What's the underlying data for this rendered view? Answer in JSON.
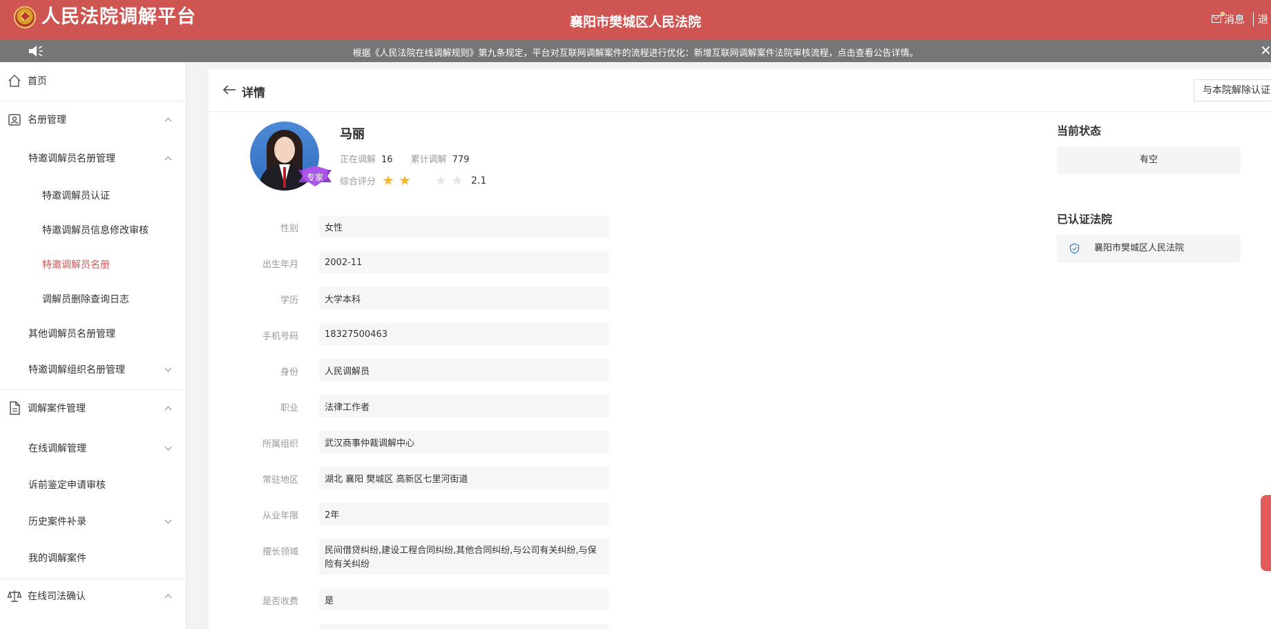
{
  "header": {
    "app_title": "人民法院调解平台",
    "court_name": "襄阳市樊城区人民法院",
    "messages_label": "消息",
    "logout_label": "退"
  },
  "notice": {
    "text": "根据《人民法院在线调解规则》第九条规定，平台对互联网调解案件的流程进行优化：新增互联网调解案件法院审核流程，点击查看公告详情。",
    "close": "✕"
  },
  "sidebar": {
    "items": [
      {
        "label": "首页"
      },
      {
        "label": "名册管理"
      },
      {
        "label": "特邀调解员名册管理"
      },
      {
        "label": "特邀调解员认证"
      },
      {
        "label": "特邀调解员信息修改审核"
      },
      {
        "label": "特邀调解员名册"
      },
      {
        "label": "调解员删除查询日志"
      },
      {
        "label": "其他调解员名册管理"
      },
      {
        "label": "特邀调解组织名册管理"
      },
      {
        "label": "调解案件管理"
      },
      {
        "label": "在线调解管理"
      },
      {
        "label": "诉前鉴定申请审核"
      },
      {
        "label": "历史案件补录"
      },
      {
        "label": "我的调解案件"
      },
      {
        "label": "在线司法确认"
      }
    ]
  },
  "detail": {
    "title": "详情",
    "revoke_button": "与本院解除认证",
    "badge": "专家",
    "name": "马丽",
    "ongoing_label": "正在调解",
    "ongoing_value": "16",
    "total_label": "累计调解",
    "total_value": "779",
    "rating_label": "综合评分",
    "rating_value": "2.1",
    "fields": [
      {
        "label": "性别",
        "value": "女性"
      },
      {
        "label": "出生年月",
        "value": "2002-11"
      },
      {
        "label": "学历",
        "value": "大学本科"
      },
      {
        "label": "手机号码",
        "value": "18327500463"
      },
      {
        "label": "身份",
        "value": "人民调解员"
      },
      {
        "label": "职业",
        "value": "法律工作者"
      },
      {
        "label": "所属组织",
        "value": "武汉商事仲裁调解中心"
      },
      {
        "label": "常驻地区",
        "value": "湖北 襄阳 樊城区 高新区七里河街道"
      },
      {
        "label": "从业年限",
        "value": "2年"
      },
      {
        "label": "擅长领域",
        "value": "民间借贷纠纷,建设工程合同纠纷,其他合同纠纷,与公司有关纠纷,与保险有关纠纷"
      },
      {
        "label": "是否收费",
        "value": "是"
      }
    ]
  },
  "status": {
    "title": "当前状态",
    "value": "有空"
  },
  "certified": {
    "title": "已认证法院",
    "court": "襄阳市樊城区人民法院"
  },
  "colors": {
    "brand": "#cf5552",
    "notice_bg": "#767676",
    "star_on": "#f5b72b",
    "star_off": "#e6e6e6",
    "badge": "#a855e8"
  }
}
